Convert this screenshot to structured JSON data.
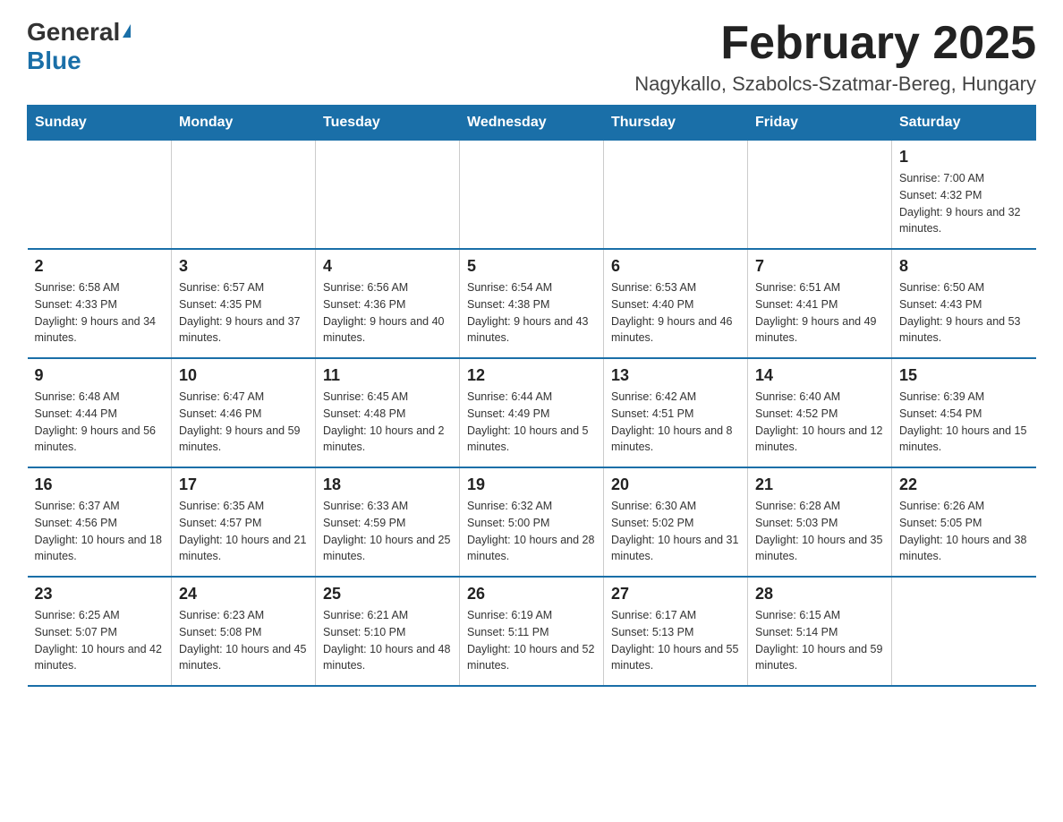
{
  "header": {
    "logo_general": "General",
    "logo_blue": "Blue",
    "title": "February 2025",
    "subtitle": "Nagykallo, Szabolcs-Szatmar-Bereg, Hungary"
  },
  "days_of_week": [
    "Sunday",
    "Monday",
    "Tuesday",
    "Wednesday",
    "Thursday",
    "Friday",
    "Saturday"
  ],
  "weeks": [
    [
      {
        "day": "",
        "info": ""
      },
      {
        "day": "",
        "info": ""
      },
      {
        "day": "",
        "info": ""
      },
      {
        "day": "",
        "info": ""
      },
      {
        "day": "",
        "info": ""
      },
      {
        "day": "",
        "info": ""
      },
      {
        "day": "1",
        "info": "Sunrise: 7:00 AM\nSunset: 4:32 PM\nDaylight: 9 hours and 32 minutes."
      }
    ],
    [
      {
        "day": "2",
        "info": "Sunrise: 6:58 AM\nSunset: 4:33 PM\nDaylight: 9 hours and 34 minutes."
      },
      {
        "day": "3",
        "info": "Sunrise: 6:57 AM\nSunset: 4:35 PM\nDaylight: 9 hours and 37 minutes."
      },
      {
        "day": "4",
        "info": "Sunrise: 6:56 AM\nSunset: 4:36 PM\nDaylight: 9 hours and 40 minutes."
      },
      {
        "day": "5",
        "info": "Sunrise: 6:54 AM\nSunset: 4:38 PM\nDaylight: 9 hours and 43 minutes."
      },
      {
        "day": "6",
        "info": "Sunrise: 6:53 AM\nSunset: 4:40 PM\nDaylight: 9 hours and 46 minutes."
      },
      {
        "day": "7",
        "info": "Sunrise: 6:51 AM\nSunset: 4:41 PM\nDaylight: 9 hours and 49 minutes."
      },
      {
        "day": "8",
        "info": "Sunrise: 6:50 AM\nSunset: 4:43 PM\nDaylight: 9 hours and 53 minutes."
      }
    ],
    [
      {
        "day": "9",
        "info": "Sunrise: 6:48 AM\nSunset: 4:44 PM\nDaylight: 9 hours and 56 minutes."
      },
      {
        "day": "10",
        "info": "Sunrise: 6:47 AM\nSunset: 4:46 PM\nDaylight: 9 hours and 59 minutes."
      },
      {
        "day": "11",
        "info": "Sunrise: 6:45 AM\nSunset: 4:48 PM\nDaylight: 10 hours and 2 minutes."
      },
      {
        "day": "12",
        "info": "Sunrise: 6:44 AM\nSunset: 4:49 PM\nDaylight: 10 hours and 5 minutes."
      },
      {
        "day": "13",
        "info": "Sunrise: 6:42 AM\nSunset: 4:51 PM\nDaylight: 10 hours and 8 minutes."
      },
      {
        "day": "14",
        "info": "Sunrise: 6:40 AM\nSunset: 4:52 PM\nDaylight: 10 hours and 12 minutes."
      },
      {
        "day": "15",
        "info": "Sunrise: 6:39 AM\nSunset: 4:54 PM\nDaylight: 10 hours and 15 minutes."
      }
    ],
    [
      {
        "day": "16",
        "info": "Sunrise: 6:37 AM\nSunset: 4:56 PM\nDaylight: 10 hours and 18 minutes."
      },
      {
        "day": "17",
        "info": "Sunrise: 6:35 AM\nSunset: 4:57 PM\nDaylight: 10 hours and 21 minutes."
      },
      {
        "day": "18",
        "info": "Sunrise: 6:33 AM\nSunset: 4:59 PM\nDaylight: 10 hours and 25 minutes."
      },
      {
        "day": "19",
        "info": "Sunrise: 6:32 AM\nSunset: 5:00 PM\nDaylight: 10 hours and 28 minutes."
      },
      {
        "day": "20",
        "info": "Sunrise: 6:30 AM\nSunset: 5:02 PM\nDaylight: 10 hours and 31 minutes."
      },
      {
        "day": "21",
        "info": "Sunrise: 6:28 AM\nSunset: 5:03 PM\nDaylight: 10 hours and 35 minutes."
      },
      {
        "day": "22",
        "info": "Sunrise: 6:26 AM\nSunset: 5:05 PM\nDaylight: 10 hours and 38 minutes."
      }
    ],
    [
      {
        "day": "23",
        "info": "Sunrise: 6:25 AM\nSunset: 5:07 PM\nDaylight: 10 hours and 42 minutes."
      },
      {
        "day": "24",
        "info": "Sunrise: 6:23 AM\nSunset: 5:08 PM\nDaylight: 10 hours and 45 minutes."
      },
      {
        "day": "25",
        "info": "Sunrise: 6:21 AM\nSunset: 5:10 PM\nDaylight: 10 hours and 48 minutes."
      },
      {
        "day": "26",
        "info": "Sunrise: 6:19 AM\nSunset: 5:11 PM\nDaylight: 10 hours and 52 minutes."
      },
      {
        "day": "27",
        "info": "Sunrise: 6:17 AM\nSunset: 5:13 PM\nDaylight: 10 hours and 55 minutes."
      },
      {
        "day": "28",
        "info": "Sunrise: 6:15 AM\nSunset: 5:14 PM\nDaylight: 10 hours and 59 minutes."
      },
      {
        "day": "",
        "info": ""
      }
    ]
  ],
  "colors": {
    "header_bg": "#1a6fa8",
    "header_text": "#ffffff",
    "border": "#1a6fa8"
  }
}
